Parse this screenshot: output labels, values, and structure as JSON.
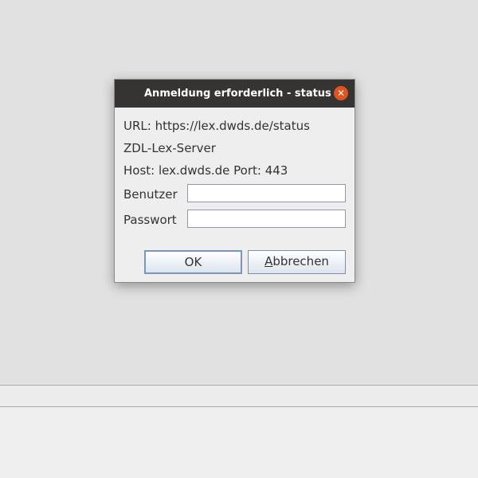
{
  "dialog": {
    "title": "Anmeldung erforderlich - status",
    "close_symbol": "✕",
    "url_line": "URL: https://lex.dwds.de/status",
    "realm_line": "ZDL-Lex-Server",
    "host_line": "Host: lex.dwds.de Port: 443",
    "username_label": "Benutzer",
    "username_value": "",
    "password_label": "Passwort",
    "password_value": "",
    "ok_label": "OK",
    "cancel_label_mnemonic": "A",
    "cancel_label_rest": "bbrechen"
  },
  "icons": {
    "close": "close-icon"
  },
  "colors": {
    "titlebar": "#353432",
    "close_button": "#e2531f",
    "dialog_background": "#eeeeee",
    "desktop_background": "#e1e1e1"
  }
}
